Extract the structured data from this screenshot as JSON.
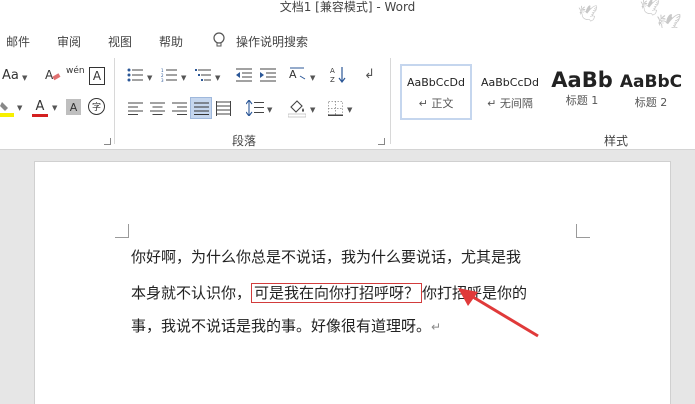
{
  "window": {
    "title": "文档1 [兼容模式]  -  Word"
  },
  "menu": {
    "items": [
      {
        "label": "邮件"
      },
      {
        "label": "审阅"
      },
      {
        "label": "视图"
      },
      {
        "label": "帮助"
      }
    ],
    "tell_me": "操作说明搜索"
  },
  "ribbon": {
    "font_controls": {
      "case_label": "Aa",
      "phonetic_label": "wén",
      "char_border_label": "A",
      "font_color_label": "A",
      "shade_label": "A",
      "enclose_label": "字",
      "font_color_hex": "#d42020",
      "highlight_hex": "#f7f000"
    },
    "paragraph_group": {
      "label": "段落"
    },
    "styles_group": {
      "label": "样式",
      "tiles": [
        {
          "sample": "AaBbCcDd",
          "name": "↵ 正文",
          "selected": true
        },
        {
          "sample": "AaBbCcDd",
          "name": "↵ 无间隔",
          "selected": false
        },
        {
          "sample": "AaBb",
          "name": "标题 1",
          "selected": false
        },
        {
          "sample": "AaBbC",
          "name": "标题 2",
          "selected": false
        }
      ]
    }
  },
  "document": {
    "line1": "你好啊，为什么你总是不说话，我为什么要说话，尤其是我",
    "line2_before": "本身就不认识你，",
    "line2_highlight": "可是我在向你打招呼呀？",
    "line2_after": "你打招呼是你的",
    "line3": "事，我说不说话是我的事。好像很有道理呀。",
    "pilcrow": "↵",
    "annotation_color": "#e03a3a"
  }
}
